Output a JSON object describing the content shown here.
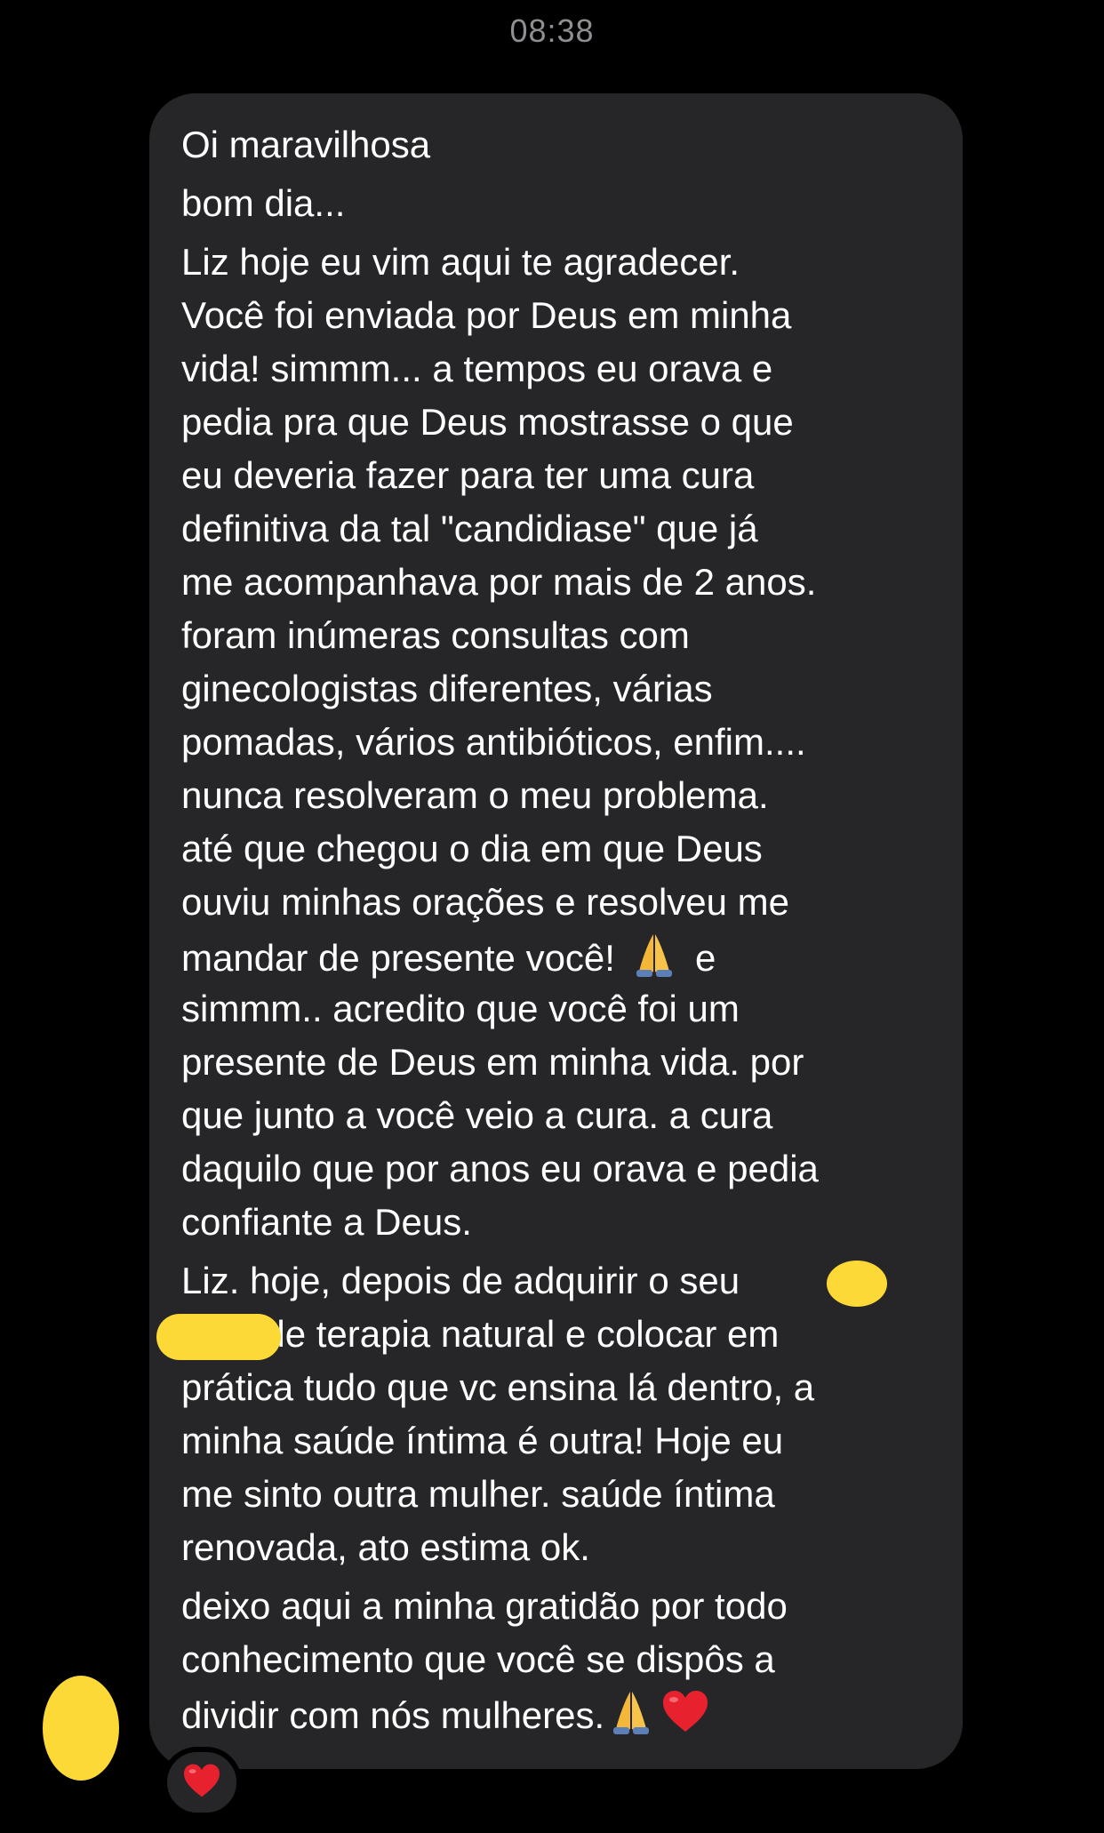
{
  "timestamp": "08:38",
  "message": {
    "paragraphs": [
      {
        "lines": [
          "Oi maravilhosa"
        ]
      },
      {
        "lines": [
          "bom dia..."
        ]
      },
      {
        "lines": [
          "Liz hoje eu vim aqui te agradecer.",
          "Você foi enviada por Deus em minha",
          "vida! simmm... a tempos eu orava e",
          "pedia pra que Deus mostrasse o que",
          "eu deveria fazer para ter uma cura",
          "definitiva da tal \"candidiase\" que já",
          "me acompanhava por mais de 2 anos.",
          "foram inúmeras  consultas com",
          "ginecologistas diferentes, várias",
          "pomadas, vários antibióticos, enfim....",
          "nunca resolveram o meu problema.",
          "até que chegou o dia em que Deus",
          "ouviu minhas orações e resolveu me",
          "mandar de presente você!",
          "simmm..  acredito que você foi um",
          "presente de Deus em minha vida. por",
          "que junto a você veio a cura. a cura",
          "daquilo que por anos eu orava e pedia",
          "confiante  a Deus."
        ],
        "pray_line_suffix": "e"
      },
      {
        "lines": [
          "Liz. hoje, depois de adquirir o seu",
          "        de terapia natural e colocar em",
          "prática tudo que vc ensina lá dentro, a",
          "minha saúde íntima é outra! Hoje eu",
          "me sinto outra mulher. saúde íntima",
          "renovada, ato estima ok."
        ]
      },
      {
        "lines": [
          "deixo aqui a minha gratidão por todo",
          "conhecimento que você se dispôs a",
          "dividir com nós mulheres."
        ]
      }
    ]
  },
  "icons": {
    "pray": "pray-icon",
    "heart": "heart-icon"
  },
  "colors": {
    "background": "#000000",
    "bubble": "#262628",
    "text": "#ffffff",
    "timestamp": "#8e8e93",
    "censor": "#fcd936",
    "heart": "#e8212e"
  }
}
